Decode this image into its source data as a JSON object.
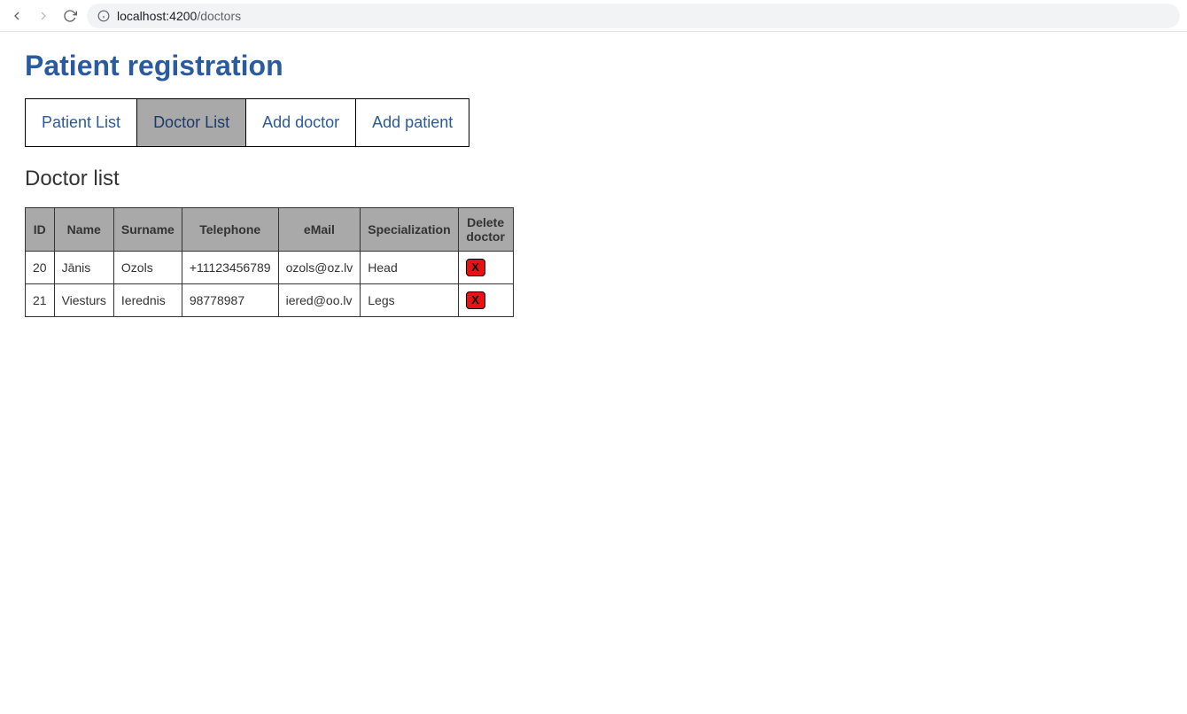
{
  "browser": {
    "url_host": "localhost:",
    "url_port": "4200",
    "url_path": "/doctors"
  },
  "page": {
    "title": "Patient registration",
    "section_title": "Doctor list"
  },
  "tabs": [
    {
      "label": "Patient List",
      "active": false
    },
    {
      "label": "Doctor List",
      "active": true
    },
    {
      "label": "Add doctor",
      "active": false
    },
    {
      "label": "Add patient",
      "active": false
    }
  ],
  "table": {
    "headers": [
      "ID",
      "Name",
      "Surname",
      "Telephone",
      "eMail",
      "Specialization",
      "Delete doctor"
    ],
    "rows": [
      {
        "id": "20",
        "name": "Jānis",
        "surname": "Ozols",
        "telephone": "+11123456789",
        "email": "ozols@oz.lv",
        "specialization": "Head"
      },
      {
        "id": "21",
        "name": "Viesturs",
        "surname": "Ierednis",
        "telephone": "98778987",
        "email": "iered@oo.lv",
        "specialization": "Legs"
      }
    ],
    "delete_label": "X"
  }
}
